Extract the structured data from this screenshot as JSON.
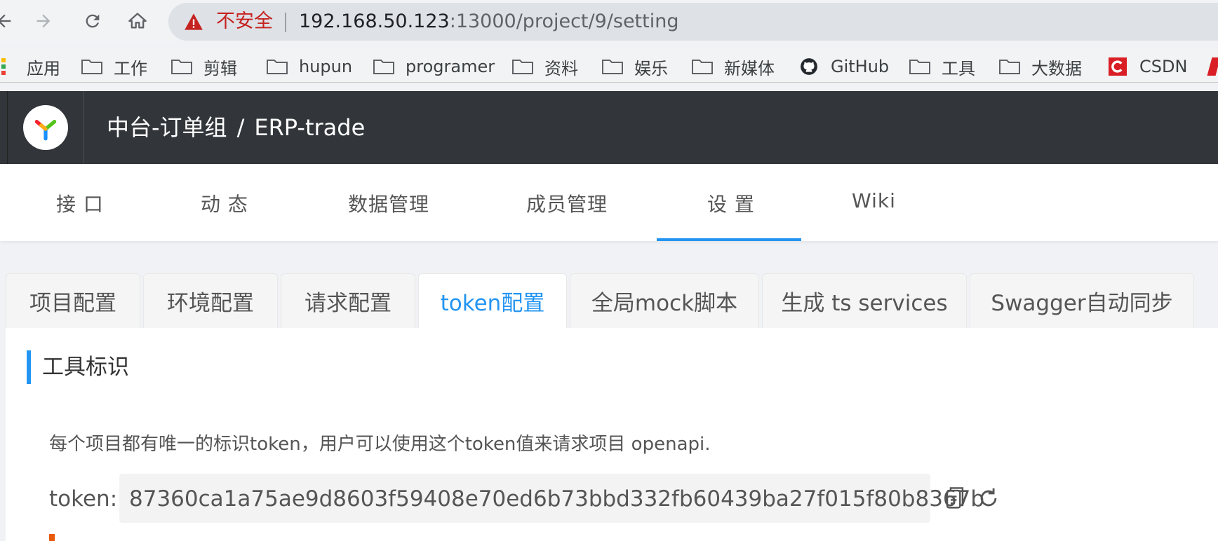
{
  "browser": {
    "insecure_label": "不安全",
    "url_host": "192.168.50.123",
    "url_rest": ":13000/project/9/setting",
    "bookmarks": [
      {
        "label": "应用",
        "icon": "apps-grid-icon"
      },
      {
        "label": "工作",
        "icon": "folder-icon"
      },
      {
        "label": "剪辑",
        "icon": "folder-icon"
      },
      {
        "label": "hupun",
        "icon": "folder-icon"
      },
      {
        "label": "programer",
        "icon": "folder-icon"
      },
      {
        "label": "资料",
        "icon": "folder-icon"
      },
      {
        "label": "娱乐",
        "icon": "folder-icon"
      },
      {
        "label": "新媒体",
        "icon": "folder-icon"
      },
      {
        "label": "GitHub",
        "icon": "github-icon"
      },
      {
        "label": "工具",
        "icon": "folder-icon"
      },
      {
        "label": "大数据",
        "icon": "folder-icon"
      },
      {
        "label": "CSDN",
        "icon": "csdn-icon"
      }
    ]
  },
  "header": {
    "group": "中台-订单组",
    "separator": "/",
    "project": "ERP-trade"
  },
  "primary_tabs": [
    {
      "label": "接 口"
    },
    {
      "label": "动 态"
    },
    {
      "label": "数据管理"
    },
    {
      "label": "成员管理"
    },
    {
      "label": "设 置",
      "active": true
    },
    {
      "label": "Wiki"
    }
  ],
  "secondary_tabs": [
    {
      "label": "项目配置"
    },
    {
      "label": "环境配置"
    },
    {
      "label": "请求配置"
    },
    {
      "label": "token配置",
      "active": true
    },
    {
      "label": "全局mock脚本"
    },
    {
      "label": "生成 ts services"
    },
    {
      "label": "Swagger自动同步"
    }
  ],
  "content": {
    "section_title": "工具标识",
    "description": "每个项目都有唯一的标识token，用户可以使用这个token值来请求项目 openapi.",
    "token_label": "token:",
    "token_value": "87360ca1a75ae9d8603f59408e70ed6b73bbd332fb60439ba27f015f80b8367b"
  },
  "colors": {
    "accent": "#2395f1",
    "header_bg": "#32363a",
    "insecure": "#c5221f"
  }
}
